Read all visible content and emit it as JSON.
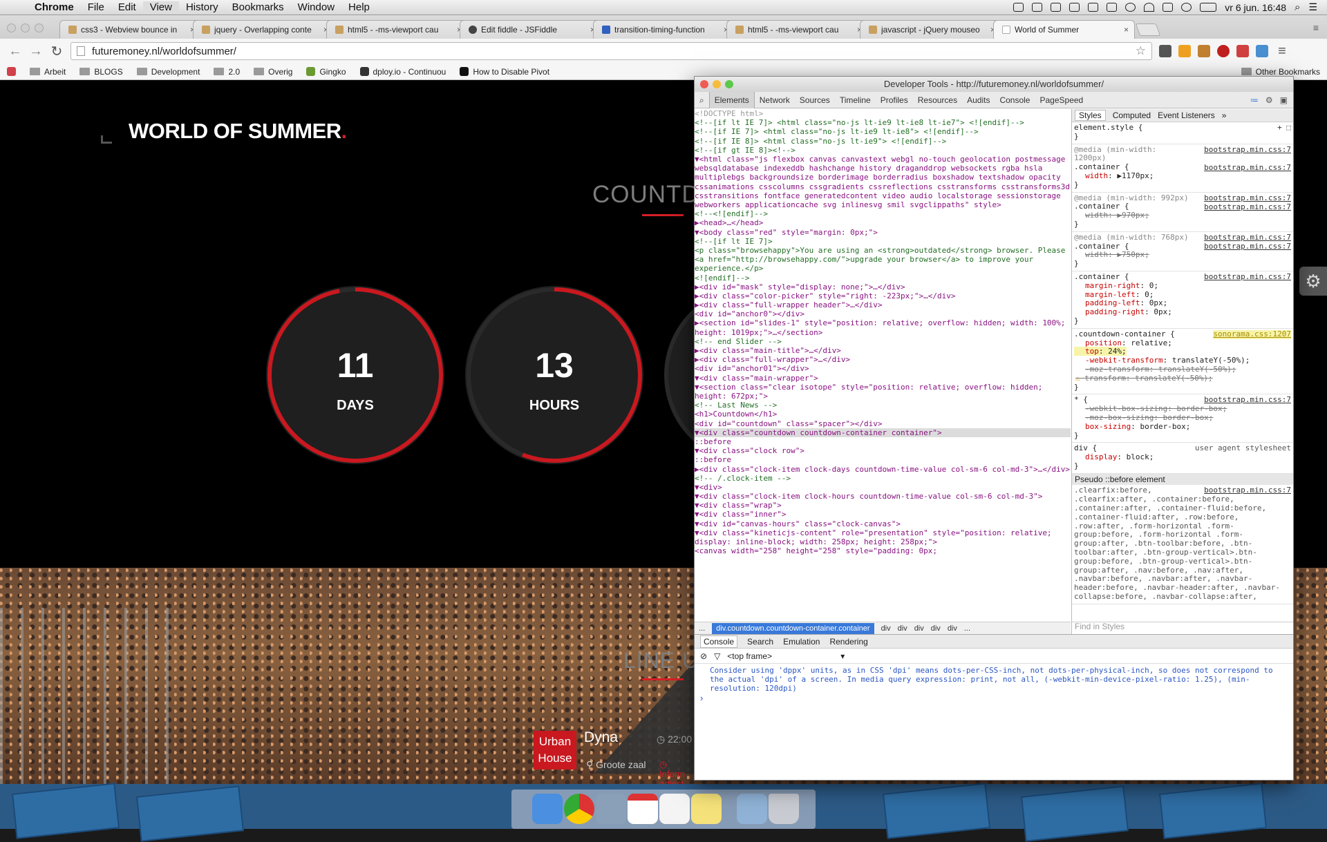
{
  "menubar": {
    "app": "Chrome",
    "items": [
      "File",
      "Edit",
      "View",
      "History",
      "Bookmarks",
      "Window",
      "Help"
    ],
    "clock": "vr 6 jun.  16:48"
  },
  "tabs": [
    {
      "title": "css3 - Webview bounce in"
    },
    {
      "title": "jquery - Overlapping conte"
    },
    {
      "title": "html5 - -ms-viewport cau"
    },
    {
      "title": "Edit fiddle - JSFiddle"
    },
    {
      "title": "transition-timing-function"
    },
    {
      "title": "html5 - -ms-viewport cau"
    },
    {
      "title": "javascript - jQuery mouseo"
    },
    {
      "title": "World of Summer",
      "active": true
    }
  ],
  "address": {
    "url": "futuremoney.nl/worldofsummer/"
  },
  "bookmarks": {
    "items": [
      "Arbeit",
      "BLOGS",
      "Development",
      "2.0",
      "Overig",
      "Gingko",
      "dploy.io - Continuou",
      "How to Disable Pivot"
    ],
    "other": "Other Bookmarks"
  },
  "page": {
    "logo": "WORLD OF SUMMER",
    "logo_dot": ".",
    "countdown_title": "COUNTDO",
    "clocks": [
      {
        "value": "11",
        "unit": "DAYS",
        "progress": 0.97
      },
      {
        "value": "13",
        "unit": "HOURS",
        "progress": 0.56
      }
    ],
    "lineup_title": "LINE UP",
    "event": {
      "stage": "Urban House",
      "artist": "Dyna",
      "time": "22:00",
      "venue": "Groote zaal",
      "info": "Inform artiest"
    }
  },
  "devtools": {
    "title": "Developer Tools - http://futuremoney.nl/worldofsummer/",
    "tabs": [
      "Elements",
      "Network",
      "Sources",
      "Timeline",
      "Profiles",
      "Resources",
      "Audits",
      "Console",
      "PageSpeed"
    ],
    "dom_lines": [
      {
        "t": "<!DOCTYPE html>",
        "c": "dim"
      },
      {
        "t": "<!--[if lt IE 7]>      <html class=\"no-js lt-ie9 lt-ie8 lt-ie7\"> <![endif]-->",
        "c": "cm"
      },
      {
        "t": "<!--[if IE 7]>         <html class=\"no-js lt-ie9 lt-ie8\"> <![endif]-->",
        "c": "cm"
      },
      {
        "t": "<!--[if IE 8]>         <html class=\"no-js lt-ie9\"> <![endif]-->",
        "c": "cm"
      },
      {
        "t": "<!--[if gt IE 8]><!-->",
        "c": "cm"
      },
      {
        "t": "▼<html class=\"js flexbox canvas canvastext webgl no-touch geolocation postmessage websqldatabase indexeddb hashchange history draganddrop websockets rgba hsla multiplebgs backgroundsize borderimage borderradius boxshadow textshadow opacity cssanimations csscolumns cssgradients cssreflections csstransforms csstransforms3d csstransitions fontface generatedcontent video audio localstorage sessionstorage webworkers applicationcache svg inlinesvg smil svgclippaths\" style>",
        "c": "tg",
        "wrap": true
      },
      {
        "t": "   <!--<![endif]-->",
        "c": "cm"
      },
      {
        "t": "  ▶<head>…</head>",
        "c": "tg"
      },
      {
        "t": "  ▼<body class=\"red\" style=\"margin: 0px;\">",
        "c": "tg"
      },
      {
        "t": "     <!--[if lt IE 7]>",
        "c": "cm"
      },
      {
        "t": "                 <p class=\"browsehappy\">You are using an <strong>outdated</strong> browser. Please <a href=\"http://browsehappy.com/\">upgrade your browser</a> to improve your experience.</p>",
        "c": "cm",
        "wrap": true
      },
      {
        "t": "             <![endif]-->",
        "c": "cm"
      },
      {
        "t": "    ▶<div id=\"mask\" style=\"display: none;\">…</div>",
        "c": "tg"
      },
      {
        "t": "    ▶<div class=\"color-picker\" style=\"right: -223px;\">…</div>",
        "c": "tg"
      },
      {
        "t": "    ▶<div class=\"full-wrapper header\">…</div>",
        "c": "tg"
      },
      {
        "t": "     <div id=\"anchor0\"></div>",
        "c": "tg"
      },
      {
        "t": "    ▶<section id=\"slides-1\" style=\"position: relative; overflow: hidden; width: 100%; height: 1019px;\">…</section>",
        "c": "tg",
        "wrap": true
      },
      {
        "t": "     <!-- end Slider -->",
        "c": "cm"
      },
      {
        "t": "    ▶<div class=\"main-title\">…</div>",
        "c": "tg"
      },
      {
        "t": "    ▶<div class=\"full-wrapper\">…</div>",
        "c": "tg"
      },
      {
        "t": "     <div id=\"anchor01\"></div>",
        "c": "tg"
      },
      {
        "t": "    ▼<div class=\"main-wrapper\">",
        "c": "tg"
      },
      {
        "t": "      ▼<section class=\"clear isotope\" style=\"position: relative; overflow: hidden; height: 672px;\">",
        "c": "tg",
        "wrap": true
      },
      {
        "t": "         <!-- Last News -->",
        "c": "cm"
      },
      {
        "t": "         <h1>Countdown</h1>",
        "c": "tg"
      },
      {
        "t": "         <div id=\"countdown\" class=\"spacer\"></div>",
        "c": "tg"
      },
      {
        "t": "       ▼<div class=\"countdown countdown-container container\">",
        "c": "tg",
        "sel": true
      },
      {
        "t": "           ::before",
        "c": "ps"
      },
      {
        "t": "         ▼<div class=\"clock row\">",
        "c": "tg"
      },
      {
        "t": "             ::before",
        "c": "ps"
      },
      {
        "t": "           ▶<div class=\"clock-item clock-days countdown-time-value col-sm-6 col-md-3\">…</div>",
        "c": "tg",
        "wrap": true
      },
      {
        "t": "             <!-- /.clock-item -->",
        "c": "cm"
      },
      {
        "t": "           ▼<div>",
        "c": "tg"
      },
      {
        "t": "             ▼<div class=\"clock-item clock-hours countdown-time-value col-sm-6 col-md-3\">",
        "c": "tg",
        "wrap": true
      },
      {
        "t": "               ▼<div class=\"wrap\">",
        "c": "tg"
      },
      {
        "t": "                 ▼<div class=\"inner\">",
        "c": "tg"
      },
      {
        "t": "                   ▼<div id=\"canvas-hours\" class=\"clock-canvas\">",
        "c": "tg"
      },
      {
        "t": "                     ▼<div class=\"kineticjs-content\" role=\"presentation\" style=\"position: relative; display: inline-block; width: 258px; height: 258px;\">",
        "c": "tg",
        "wrap": true
      },
      {
        "t": "                         <canvas width=\"258\" height=\"258\" style=\"padding: 0px;",
        "c": "tg"
      }
    ],
    "breadcrumbs": [
      "...",
      "div.countdown.countdown-container.container",
      "div",
      "div",
      "div",
      "div",
      "div",
      "..."
    ],
    "styles_tabs": [
      "Styles",
      "Computed",
      "Event Listeners",
      "»"
    ],
    "find_placeholder": "Find in Styles",
    "console_tabs": [
      "Console",
      "Search",
      "Emulation",
      "Rendering"
    ],
    "frame": "<top frame>",
    "console_message": "Consider using 'dppx' units, as in CSS 'dpi' means dots-per-CSS-inch, not dots-per-physical-inch, so does not correspond to the actual 'dpi' of a screen. In media query expression: print, not all, (-webkit-min-device-pixel-ratio: 1.25), (min-resolution: 120dpi)"
  }
}
